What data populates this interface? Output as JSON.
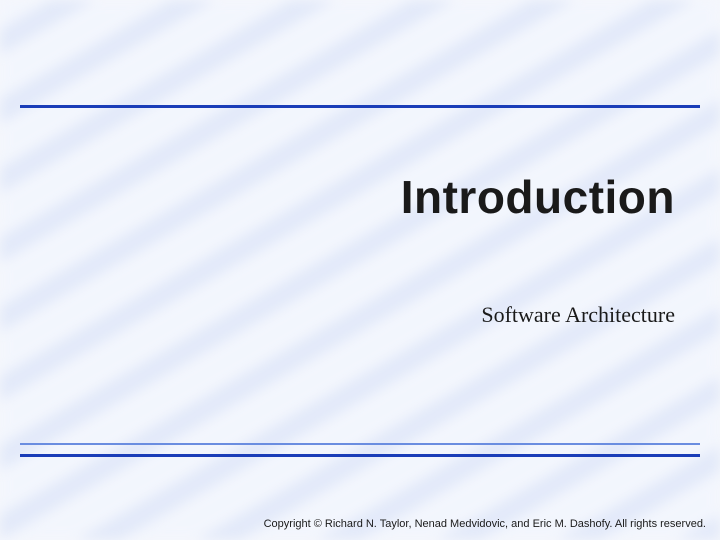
{
  "slide": {
    "title": "Introduction",
    "subtitle": "Software Architecture",
    "copyright": "Copyright © Richard N. Taylor, Nenad Medvidovic, and Eric M. Dashofy. All rights reserved."
  }
}
